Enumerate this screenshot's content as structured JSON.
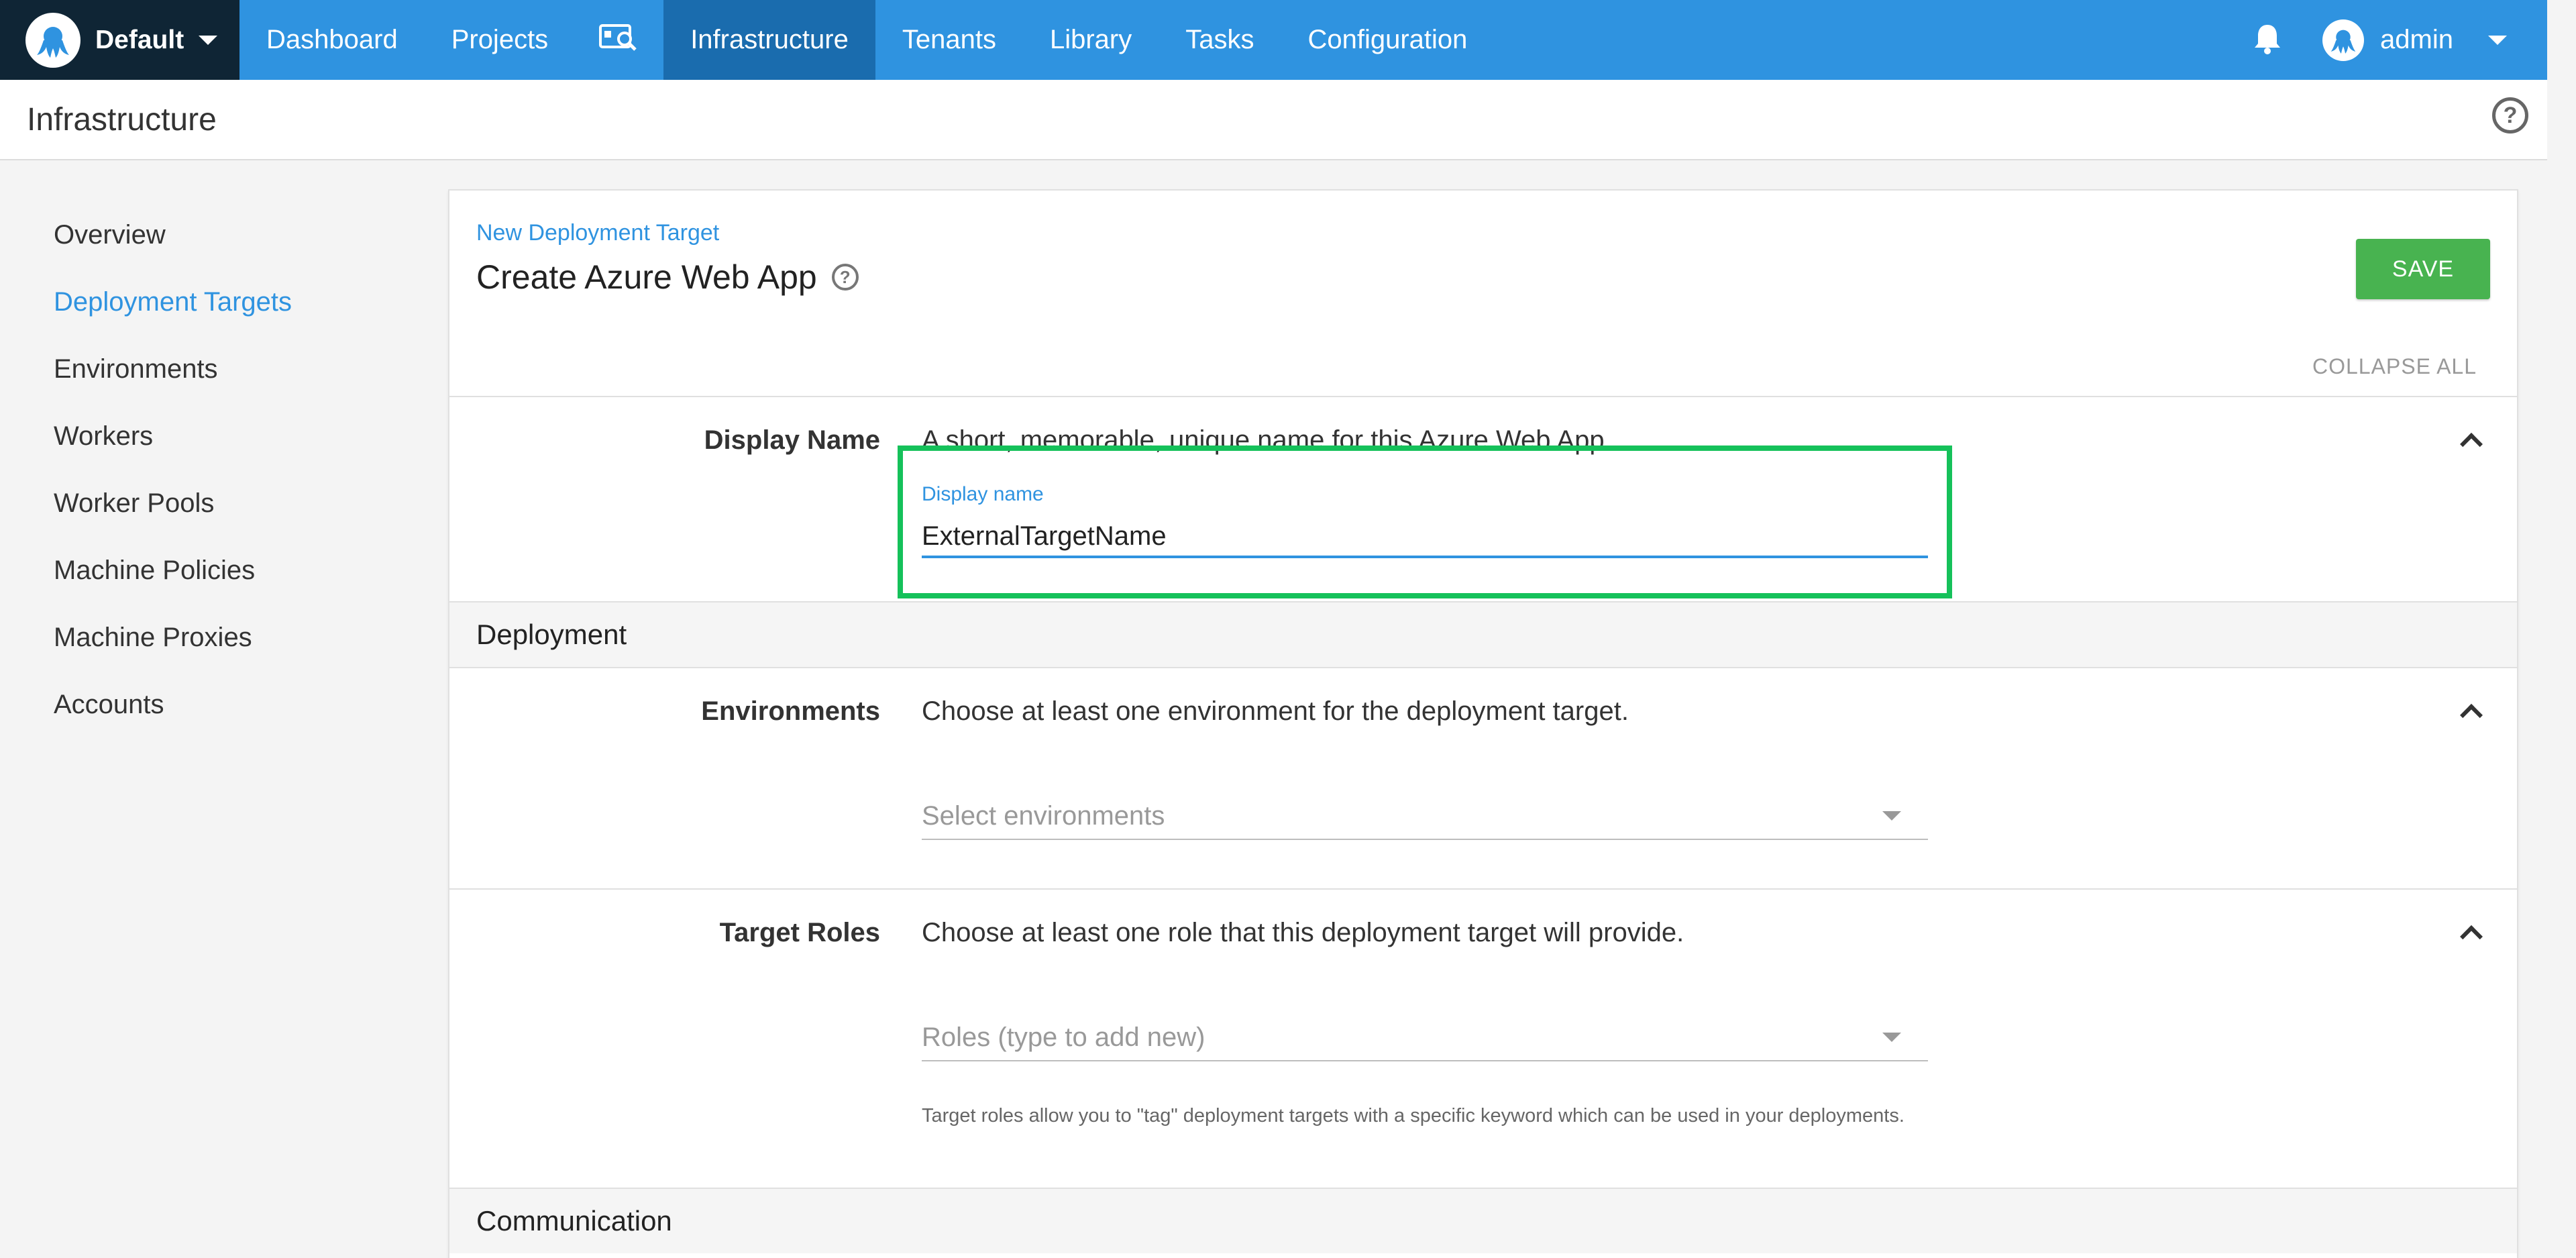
{
  "topnav": {
    "space_name": "Default",
    "items": [
      {
        "label": "Dashboard"
      },
      {
        "label": "Projects"
      },
      {
        "label": "Infrastructure",
        "active": true
      },
      {
        "label": "Tenants"
      },
      {
        "label": "Library"
      },
      {
        "label": "Tasks"
      },
      {
        "label": "Configuration"
      }
    ],
    "user_name": "admin",
    "colors": {
      "bar": "#2f93e0",
      "active": "#1a6cae",
      "space_bg": "#0f2535"
    }
  },
  "page_header": {
    "title": "Infrastructure"
  },
  "sidebar": {
    "items": [
      {
        "label": "Overview"
      },
      {
        "label": "Deployment Targets",
        "active": true
      },
      {
        "label": "Environments"
      },
      {
        "label": "Workers"
      },
      {
        "label": "Worker Pools"
      },
      {
        "label": "Machine Policies"
      },
      {
        "label": "Machine Proxies"
      },
      {
        "label": "Accounts"
      }
    ]
  },
  "card": {
    "breadcrumb": "New Deployment Target",
    "title": "Create Azure Web App",
    "save_label": "SAVE",
    "collapse_all_label": "COLLAPSE ALL",
    "display_name_section": {
      "label": "Display Name",
      "description": "A short, memorable, unique name for this Azure Web App.",
      "field_label": "Display name",
      "field_value": "ExternalTargetName"
    },
    "deployment_group": "Deployment",
    "environments_section": {
      "label": "Environments",
      "description": "Choose at least one environment for the deployment target.",
      "placeholder": "Select environments"
    },
    "roles_section": {
      "label": "Target Roles",
      "description": "Choose at least one role that this deployment target will provide.",
      "placeholder": "Roles (type to add new)",
      "hint": "Target roles allow you to \"tag\" deployment targets with a specific keyword which can be used in your deployments."
    },
    "communication_group": "Communication"
  },
  "colors": {
    "save": "#48b350",
    "link": "#2f93e0",
    "highlight": "#15c15a"
  }
}
